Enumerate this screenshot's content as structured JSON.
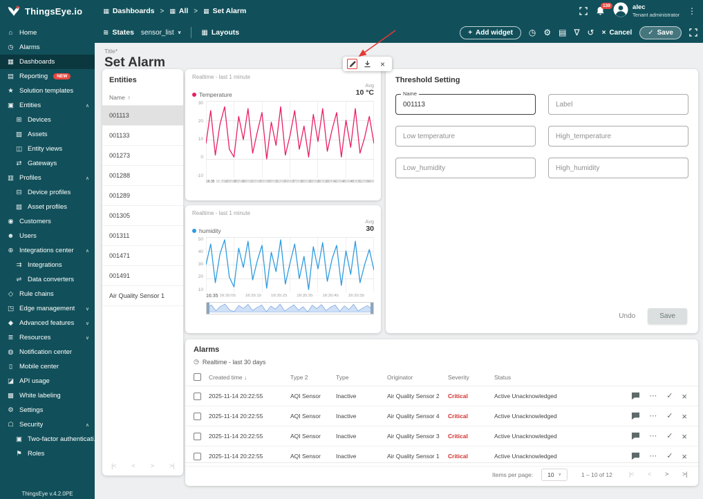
{
  "app": {
    "logo_text": "ThingsEye.io",
    "version_footer": "ThingsEye v.4.2.0PE"
  },
  "page": {
    "title_label": "Title*",
    "title_value": "Set Alarm"
  },
  "topbar": {
    "breadcrumbs": [
      {
        "label": "Dashboards"
      },
      {
        "label": "All"
      },
      {
        "label": "Set Alarm"
      }
    ],
    "notifications_badge": "139",
    "user": {
      "name": "alec",
      "role": "Tenant administrator"
    }
  },
  "subbar": {
    "states_label": "States",
    "state_value": "sensor_list",
    "layouts_label": "Layouts",
    "add_widget_label": "Add widget",
    "cancel_label": "Cancel",
    "save_label": "Save"
  },
  "sidebar": {
    "items": [
      {
        "label": "Home",
        "icon": "home",
        "glyph": "⌂"
      },
      {
        "label": "Alarms",
        "icon": "alarms",
        "glyph": "◷"
      },
      {
        "label": "Dashboards",
        "icon": "dashboards",
        "glyph": "▦",
        "active": true
      },
      {
        "label": "Reporting",
        "icon": "reporting",
        "glyph": "▤",
        "badge": "NEW"
      },
      {
        "label": "Solution templates",
        "icon": "solution-templates",
        "glyph": "★"
      },
      {
        "label": "Entities",
        "icon": "entities",
        "glyph": "▣",
        "chevron": "up"
      },
      {
        "label": "Devices",
        "icon": "devices",
        "glyph": "⊞",
        "child": true
      },
      {
        "label": "Assets",
        "icon": "assets",
        "glyph": "▨",
        "child": true
      },
      {
        "label": "Entity views",
        "icon": "entity-views",
        "glyph": "◫",
        "child": true
      },
      {
        "label": "Gateways",
        "icon": "gateways",
        "glyph": "⇄",
        "child": true
      },
      {
        "label": "Profiles",
        "icon": "profiles",
        "glyph": "▥",
        "chevron": "up"
      },
      {
        "label": "Device profiles",
        "icon": "device-profiles",
        "glyph": "⊟",
        "child": true
      },
      {
        "label": "Asset profiles",
        "icon": "asset-profiles",
        "glyph": "▧",
        "child": true
      },
      {
        "label": "Customers",
        "icon": "customers",
        "glyph": "◉"
      },
      {
        "label": "Users",
        "icon": "users",
        "glyph": "☻"
      },
      {
        "label": "Integrations center",
        "icon": "integrations-center",
        "glyph": "⊕",
        "chevron": "up"
      },
      {
        "label": "Integrations",
        "icon": "integrations",
        "glyph": "⇉",
        "child": true
      },
      {
        "label": "Data converters",
        "icon": "data-converters",
        "glyph": "⇌",
        "child": true
      },
      {
        "label": "Rule chains",
        "icon": "rule-chains",
        "glyph": "◇"
      },
      {
        "label": "Edge management",
        "icon": "edge-management",
        "glyph": "◳",
        "chevron": "down"
      },
      {
        "label": "Advanced features",
        "icon": "advanced-features",
        "glyph": "◆",
        "chevron": "down"
      },
      {
        "label": "Resources",
        "icon": "resources",
        "glyph": "≣",
        "chevron": "down"
      },
      {
        "label": "Notification center",
        "icon": "notification-center",
        "glyph": "◍"
      },
      {
        "label": "Mobile center",
        "icon": "mobile-center",
        "glyph": "▯"
      },
      {
        "label": "API usage",
        "icon": "api-usage",
        "glyph": "◪"
      },
      {
        "label": "White labeling",
        "icon": "white-labeling",
        "glyph": "▩"
      },
      {
        "label": "Settings",
        "icon": "settings",
        "glyph": "⚙"
      },
      {
        "label": "Security",
        "icon": "security",
        "glyph": "☖",
        "chevron": "up"
      },
      {
        "label": "Two-factor authenticati...",
        "icon": "two-factor-auth",
        "glyph": "▣",
        "child": true
      },
      {
        "label": "Roles",
        "icon": "roles",
        "glyph": "⚑",
        "child": true
      }
    ]
  },
  "entities_panel": {
    "title": "Entities",
    "column": "Name",
    "selected_index": 0,
    "rows": [
      "001113",
      "001133",
      "001273",
      "001288",
      "001289",
      "001305",
      "001311",
      "001471",
      "001491",
      "Air Quality Sensor 1"
    ]
  },
  "chart_data": [
    {
      "type": "line",
      "title": "Realtime - last 1 minute",
      "legend": "Temperature",
      "avg_label": "Avg",
      "avg_value": "10 °C",
      "ylim": [
        -10,
        30
      ],
      "yticks": [
        30,
        20,
        10,
        0,
        -10
      ],
      "x_labels": [
        "16:35",
        "16:35:03",
        "16:35:06",
        "16:35:09",
        "16:35:12",
        "16:35:15",
        "16:35:18",
        "16:35:21",
        "16:35:24",
        "16:35:27",
        "16:35:30",
        "16:35:33",
        "16:35:36",
        "16:35:39",
        "16:35:42",
        "16:35:45",
        "16:35:48",
        "16:35:51",
        "16:35:54",
        "16:35:57"
      ],
      "series": [
        {
          "name": "Temperature",
          "color": "#e91e63",
          "values": [
            8,
            25,
            2,
            18,
            27,
            5,
            1,
            22,
            10,
            26,
            3,
            14,
            24,
            0,
            19,
            7,
            27,
            2,
            12,
            25,
            5,
            17,
            1,
            23,
            9,
            26,
            4,
            15,
            24,
            1,
            20,
            6,
            26,
            3,
            11,
            22,
            8
          ]
        }
      ]
    },
    {
      "type": "line",
      "title": "Realtime - last 1 minute",
      "legend": "humidity",
      "avg_label": "Avg",
      "avg_value": "30",
      "ylim": [
        10,
        50
      ],
      "yticks": [
        50,
        40,
        30,
        20,
        10
      ],
      "x_labels": [
        "16:35",
        "16:35:05",
        "16:35:15",
        "16:35:25",
        "16:35:35",
        "16:35:45",
        "16:35:55"
      ],
      "brush": true,
      "series": [
        {
          "name": "humidity",
          "color": "#2e9bdf",
          "values": [
            30,
            45,
            17,
            38,
            48,
            21,
            14,
            42,
            28,
            47,
            19,
            33,
            44,
            13,
            39,
            25,
            48,
            16,
            31,
            45,
            20,
            36,
            12,
            43,
            27,
            46,
            18,
            34,
            44,
            15,
            40,
            23,
            47,
            17,
            30,
            41,
            26
          ]
        }
      ]
    }
  ],
  "threshold": {
    "title": "Threshold Setting",
    "name_label": "Name",
    "name_value": "001113",
    "label_placeholder": "Label",
    "low_temp_placeholder": "Low temperature",
    "high_temp_placeholder": "High_temperature",
    "low_hum_placeholder": "Low_humidity",
    "high_hum_placeholder": "High_humidity",
    "undo_label": "Undo",
    "save_label": "Save"
  },
  "alarms": {
    "title": "Alarms",
    "subtitle": "Realtime - last 30 days",
    "columns": [
      "Created time",
      "Type 2",
      "Type",
      "Originator",
      "Severity",
      "Status"
    ],
    "rows": [
      {
        "created": "2025-11-14 20:22:55",
        "type2": "AQI Sensor",
        "type": "Inactive",
        "originator": "Air Quality Sensor 2",
        "severity": "Critical",
        "status": "Active Unacknowledged"
      },
      {
        "created": "2025-11-14 20:22:55",
        "type2": "AQI Sensor",
        "type": "Inactive",
        "originator": "Air Quality Sensor 4",
        "severity": "Critical",
        "status": "Active Unacknowledged"
      },
      {
        "created": "2025-11-14 20:22:55",
        "type2": "AQI Sensor",
        "type": "Inactive",
        "originator": "Air Quality Sensor 3",
        "severity": "Critical",
        "status": "Active Unacknowledged"
      },
      {
        "created": "2025-11-14 20:22:55",
        "type2": "AQI Sensor",
        "type": "Inactive",
        "originator": "Air Quality Sensor 1",
        "severity": "Critical",
        "status": "Active Unacknowledged"
      }
    ],
    "items_per_page_label": "Items per page:",
    "items_per_page": "10",
    "range": "1 – 10 of 12"
  },
  "icons": {
    "crumb": "▦",
    "chevron_right": ">",
    "states": "≋",
    "layouts": "▦",
    "plus": "+",
    "clock": "◷",
    "gear": "⚙",
    "image": "▤",
    "filter": "∇",
    "history": "↺",
    "close": "×",
    "check": "✓",
    "kebab": "⋮",
    "caret_down": "∨",
    "sort_asc": "↑",
    "sort_desc": "↓",
    "dots": "⋯",
    "first_page": "|<",
    "prev_page": "<",
    "next_page": ">",
    "last_page": ">|"
  },
  "colors": {
    "topbar": "#11505a",
    "critical": "#d32f2f",
    "annotation": "#e53935",
    "badge": "#e8483f",
    "temperature": "#e91e63",
    "humidity": "#2e9bdf"
  }
}
